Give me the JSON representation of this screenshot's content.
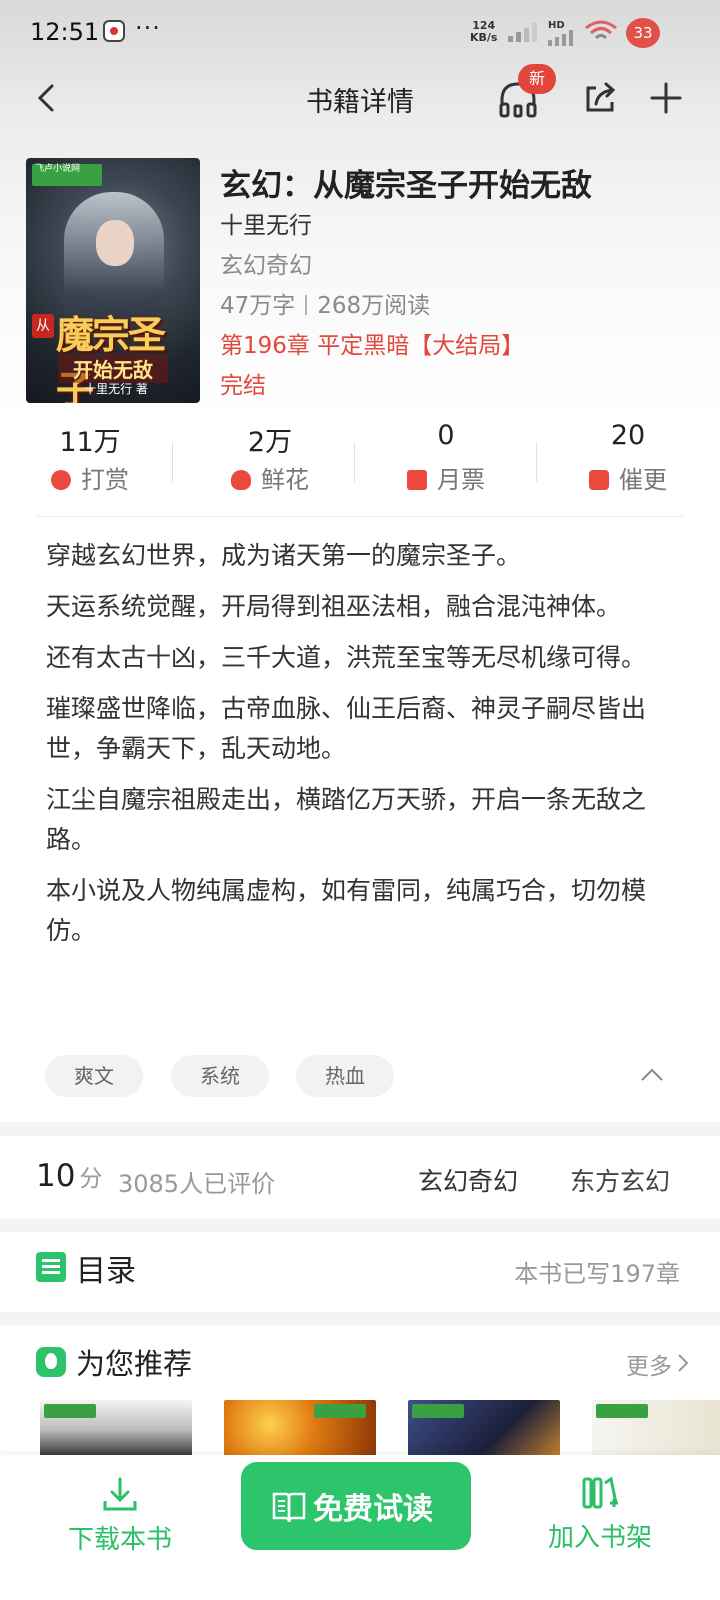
{
  "status_bar": {
    "time": "12:51",
    "dots": "···",
    "net_speed_value": "124",
    "net_speed_unit": "KB/s",
    "network_label": "HD",
    "battery": "33"
  },
  "nav": {
    "title": "书籍详情",
    "new_badge": "新"
  },
  "book": {
    "title": "玄幻：从魔宗圣子开始无敌",
    "author": "十里无行",
    "category": "玄幻奇幻",
    "word_count": "47万字",
    "reads": "268万阅读",
    "latest_chapter": "第196章 平定黑暗【大结局】",
    "status": "完结",
    "cover": {
      "site_logo": "飞卢小说网",
      "from_char": "从",
      "main_title": "魔宗圣子",
      "subtitle": "开始无敌",
      "author": "十里无行 著"
    }
  },
  "stats": [
    {
      "value": "11万",
      "label": "打赏",
      "icon": "reward-icon"
    },
    {
      "value": "2万",
      "label": "鲜花",
      "icon": "flower-icon"
    },
    {
      "value": "0",
      "label": "月票",
      "icon": "ticket-icon"
    },
    {
      "value": "20",
      "label": "催更",
      "icon": "urge-icon"
    }
  ],
  "description": [
    "穿越玄幻世界，成为诸天第一的魔宗圣子。",
    "天运系统觉醒，开局得到祖巫法相，融合混沌神体。",
    "还有太古十凶，三千大道，洪荒至宝等无尽机缘可得。",
    "璀璨盛世降临，古帝血脉、仙王后裔、神灵子嗣尽皆出世，争霸天下，乱天动地。",
    "江尘自魔宗祖殿走出，横踏亿万天骄，开启一条无敌之路。",
    "本小说及人物纯属虚构，如有雷同，纯属巧合，切勿模仿。"
  ],
  "tags": [
    "爽文",
    "系统",
    "热血"
  ],
  "rating": {
    "score": "10",
    "unit": "分",
    "reviewers": "3085人已评价",
    "genre_primary": "玄幻奇幻",
    "genre_secondary": "东方玄幻"
  },
  "catalog": {
    "title": "目录",
    "count": "本书已写197章"
  },
  "recommend": {
    "title": "为您推荐",
    "more": "更多"
  },
  "bottom": {
    "download": "下载本书",
    "read": "免费试读",
    "shelf": "加入书架"
  },
  "colors": {
    "accent_green": "#2cc56c",
    "highlight_red": "#e2483d"
  }
}
